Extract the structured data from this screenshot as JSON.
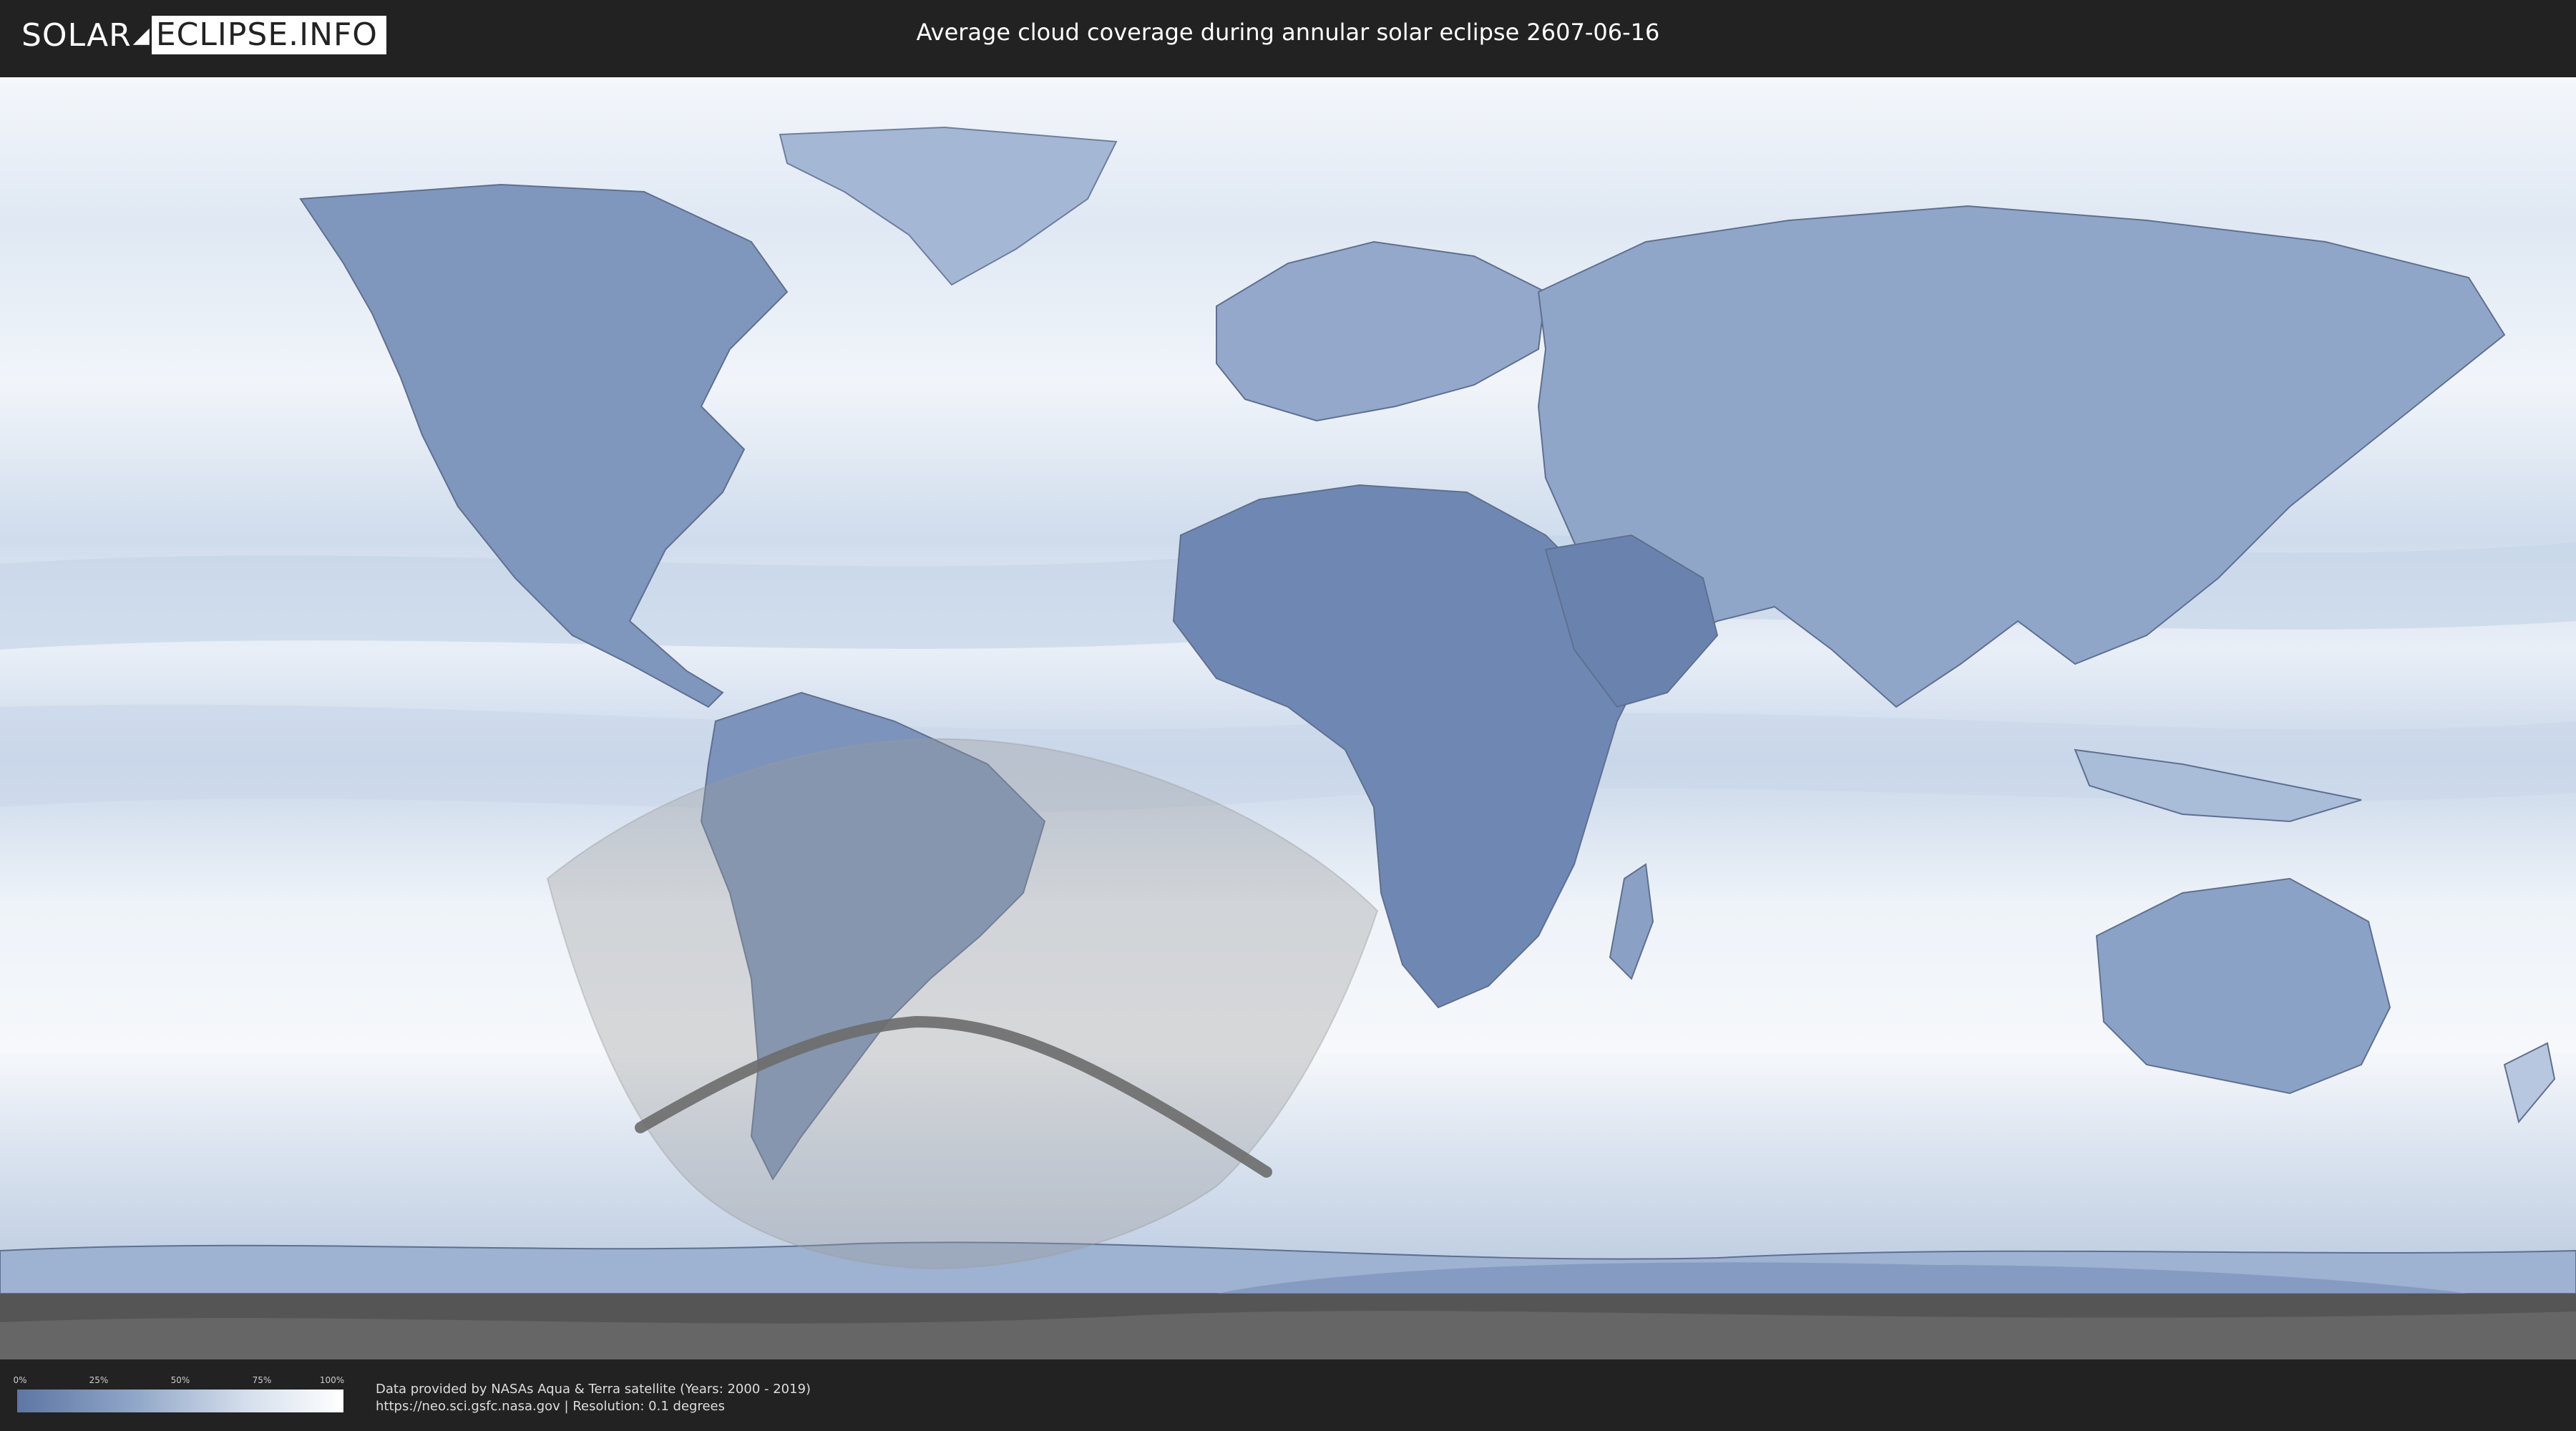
{
  "header": {
    "logo_left": "SOLAR",
    "logo_right": "ECLIPSE.INFO",
    "title": "Average cloud coverage during annular solar eclipse 2607-06-16"
  },
  "legend": {
    "ticks": [
      "0%",
      "25%",
      "50%",
      "75%",
      "100%"
    ],
    "colors": {
      "low": "#5d76a3",
      "high": "#ffffff"
    }
  },
  "footer": {
    "credit_line1": "Data provided by NASAs Aqua & Terra satellite (Years: 2000 - 2019)",
    "credit_line2": "https://neo.sci.gsfc.nasa.gov | Resolution: 0.1 degrees"
  },
  "map": {
    "colors": {
      "ocean_light": "#eef3f9",
      "cloud_band": "#c2d2e6",
      "land_clear": "#6f88b3",
      "land_mid": "#8ea6c9",
      "eclipse_overlay": "#9a9a9a",
      "central_line": "#6b6b6b"
    }
  }
}
